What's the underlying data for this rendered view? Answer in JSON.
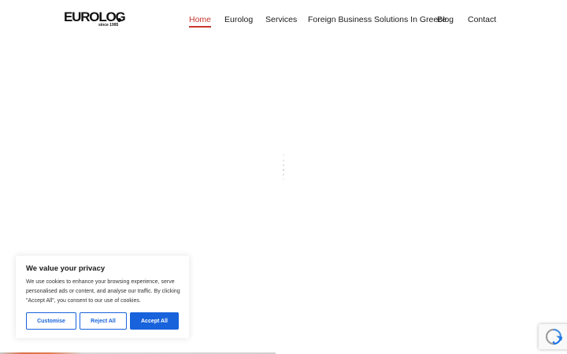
{
  "header": {
    "logo_text": "EUROLOG",
    "logo_tagline": "since 1995",
    "nav": [
      {
        "label": "Home",
        "active": true
      },
      {
        "label": "Eurolog",
        "active": false
      },
      {
        "label": "Services",
        "active": false
      },
      {
        "label": "Foreign Business Solutions In Greece",
        "active": false
      },
      {
        "label": "Blog",
        "active": false
      },
      {
        "label": "Contact",
        "active": false
      }
    ]
  },
  "cookie_banner": {
    "title": "We value your privacy",
    "text": "We use cookies to enhance your browsing experience, serve personalised ads or content, and analyse our traffic. By clicking \"Accept All\", you consent to our use of cookies.",
    "buttons": {
      "customise": "Customise",
      "reject": "Reject All",
      "accept": "Accept All"
    }
  },
  "colors": {
    "accent_red": "#c8372d",
    "cookie_blue": "#1863dc"
  },
  "icons": {
    "recaptcha": "recaptcha-icon",
    "loader": "loading-spinner-icon"
  }
}
